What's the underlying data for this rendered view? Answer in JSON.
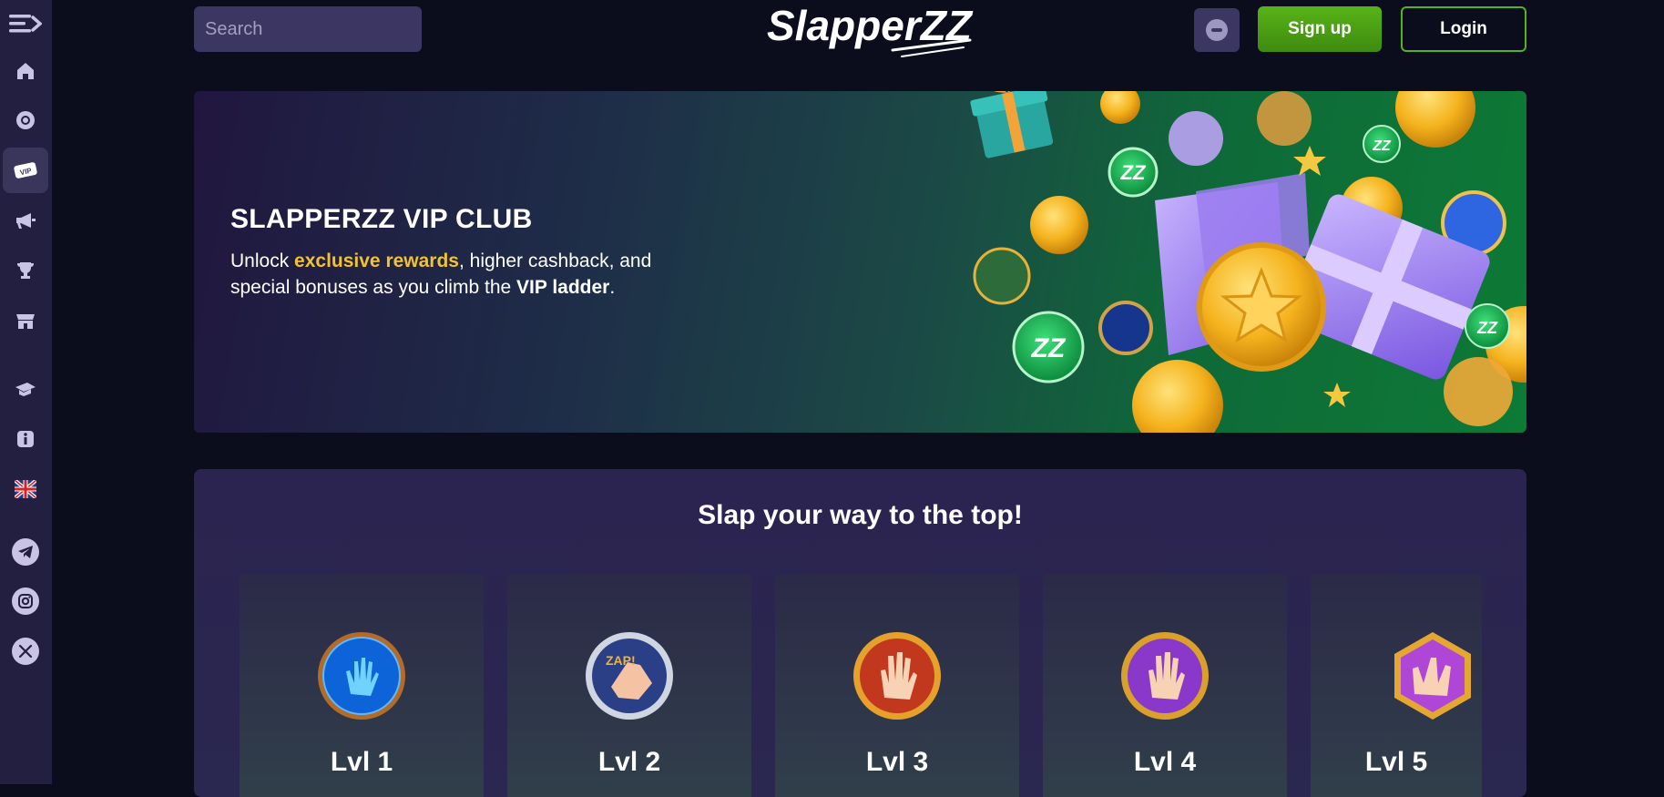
{
  "header": {
    "search_placeholder": "Search",
    "brand": "SlapperZZ",
    "signup_label": "Sign up",
    "login_label": "Login"
  },
  "sidebar": {
    "items": [
      {
        "name": "menu-toggle-icon"
      },
      {
        "name": "home-icon"
      },
      {
        "name": "casino-chip-icon"
      },
      {
        "name": "vip-icon",
        "active": true
      },
      {
        "name": "promotions-megaphone-icon"
      },
      {
        "name": "trophy-icon"
      },
      {
        "name": "shop-icon"
      },
      {
        "name": "graduation-cap-icon"
      },
      {
        "name": "info-icon"
      },
      {
        "name": "uk-flag-icon"
      },
      {
        "name": "telegram-icon"
      },
      {
        "name": "instagram-icon"
      },
      {
        "name": "x-twitter-icon"
      }
    ]
  },
  "hero": {
    "title": "SLAPPERZZ VIP CLUB",
    "text_1": "Unlock ",
    "highlight": "exclusive rewards",
    "text_2": ", higher cashback, and special bonuses as you climb the ",
    "bold": "VIP ladder",
    "text_3": "."
  },
  "levels": {
    "heading": "Slap your way to the top!",
    "items": [
      {
        "label": "Lvl 1"
      },
      {
        "label": "Lvl 2"
      },
      {
        "label": "Lvl 3"
      },
      {
        "label": "Lvl 4"
      },
      {
        "label": "Lvl 5"
      }
    ]
  },
  "colors": {
    "background": "#0b0c1c",
    "sidebar": "#231f40",
    "accent_green": "#58b318",
    "highlight_yellow": "#f2c230",
    "panel": "#2b2450"
  }
}
